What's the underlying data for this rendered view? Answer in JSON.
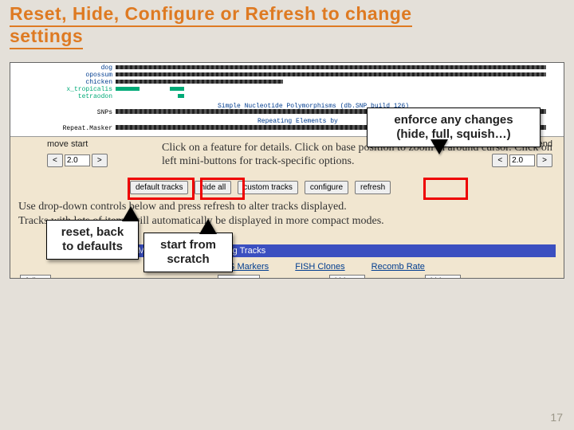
{
  "title_line1": "Reset, Hide, Configure or Refresh to change",
  "title_line2": "settings",
  "tracks": {
    "labels": [
      "dog",
      "opossum",
      "chicken",
      "x_tropicalis",
      "tetraodon"
    ],
    "snps_label": "SNPs",
    "snps_caption": "Simple Nucleotide Polymorphisms (db.SNP build 126)",
    "repeat_label": "Repeat.Masker",
    "repeat_caption": "Repeating Elements by"
  },
  "body_p1": "Click on a feature for details. Click on base position to zoom in around cursor. Click on left mini-buttons for track-specific options.",
  "body_p2": "Use drop-down controls below and press refresh to alter tracks displayed.",
  "body_p3": "Tracks with lots of items will automatically be displayed in more compact modes.",
  "move": {
    "start_label": "move start",
    "end_label": "move end",
    "lt": "<",
    "gt": ">",
    "val": "2.0",
    "val2": "2.0"
  },
  "btns": {
    "default": "default tracks",
    "hide": "hide all",
    "custom": "custom tracks",
    "configure": "configure",
    "refresh": "refresh"
  },
  "section_title": "Mapping and Sequencing Tracks",
  "section_cols": [
    "STS Markers",
    "FISH Clones",
    "Recomb Rate"
  ],
  "selects": {
    "full": "full",
    "cense": "cense",
    "hide": "hide"
  },
  "callouts": {
    "enforce_l1": "enforce any changes",
    "enforce_l2": "(hide, full, squish…)",
    "reset_l1": "reset, back",
    "reset_l2": "to defaults",
    "start_l1": "start from",
    "start_l2": "scratch"
  },
  "pagenum": "17"
}
